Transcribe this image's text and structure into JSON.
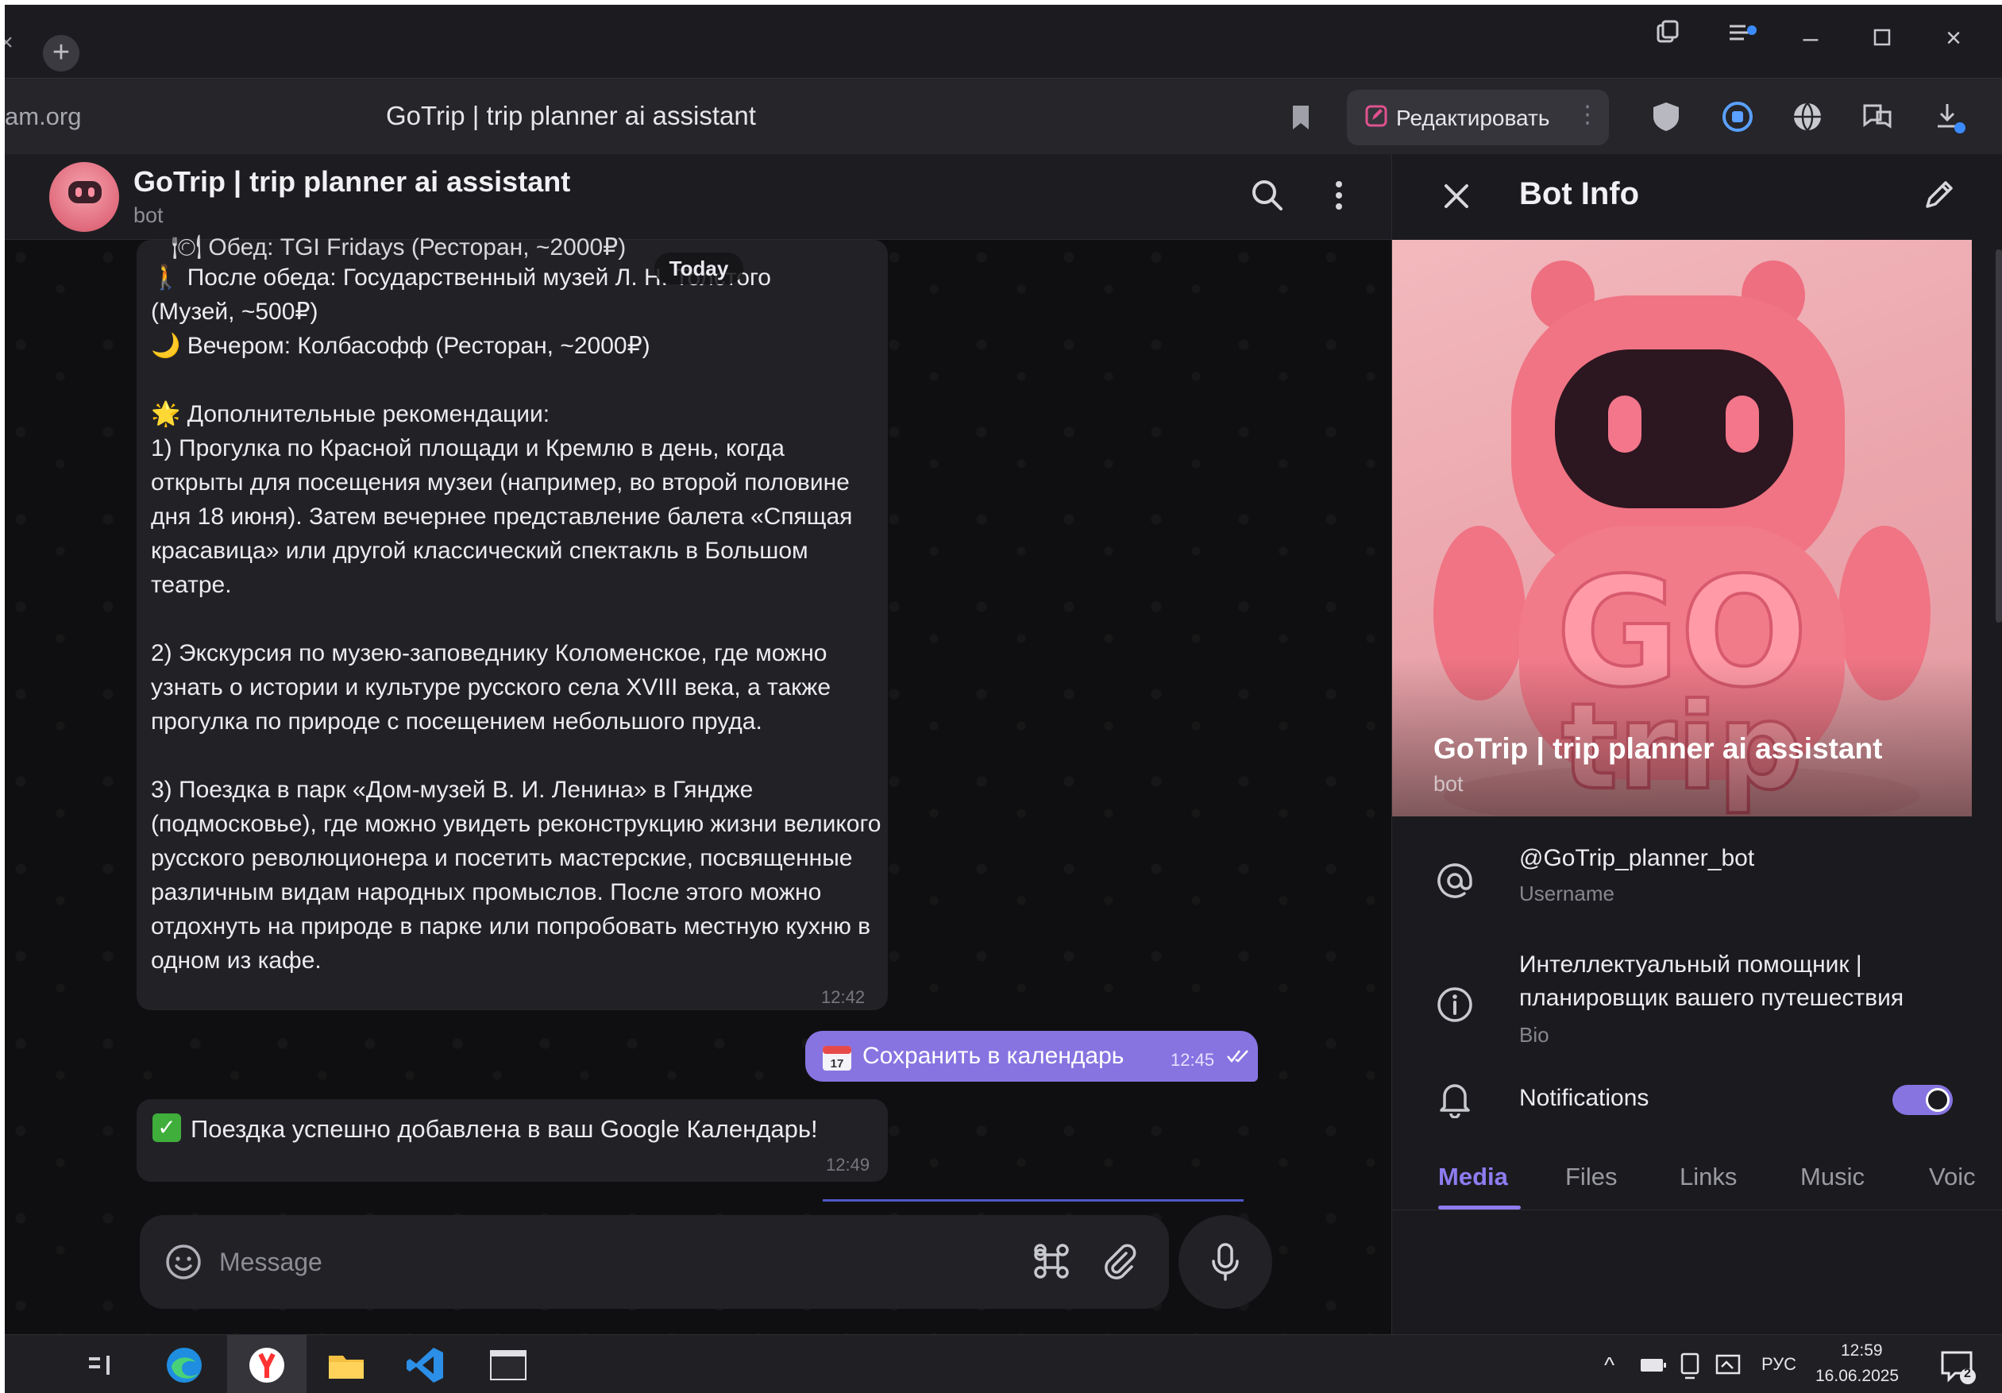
{
  "browser": {
    "url_fragment": "am.org",
    "page_title": "GoTrip | trip planner ai assistant",
    "edit_button_label": "Редактировать"
  },
  "chat": {
    "title": "GoTrip | trip planner ai assistant",
    "subtitle": "bot",
    "today_label": "Today",
    "long_message": {
      "clipped_first_line": "🍽 Обед: TGI Fridays (Ресторан, ~2000₽)",
      "text": "🚶 После обеда: Государственный музей Л. Н. Толстого\n(Музей, ~500₽)\n🌙 Вечером: Колбасофф (Ресторан, ~2000₽)\n\n🌟 Дополнительные рекомендации:\n1) Прогулка по Красной площади и Кремлю в день, когда открыты для посещения музеи (например, во второй половине дня 18 июня). Затем вечернее представление балета «Спящая красавица» или другой классический спектакль в Большом театре.\n\n2) Экскурсия по музею-заповеднику Коломенское, где можно узнать о истории и культуре русского села XVIII века, а также прогулка по природе с посещением небольшого пруда.\n\n3) Поездка в парк «Дом-музей В. И. Ленина» в Гяндже (подмосковье), где можно увидеть реконструкцию жизни великого русского революционера и посетить мастерские, посвященные различным видам народных промыслов. После этого можно отдохнуть на природе в парке или попробовать местную кухню в одном из кафе.",
      "time": "12:42"
    },
    "outgoing": {
      "label": "Сохранить в календарь",
      "time": "12:45"
    },
    "confirmation": {
      "text": "Поездка успешно добавлена в ваш Google Календарь!",
      "time": "12:49"
    },
    "composer": {
      "placeholder": "Message"
    }
  },
  "bot_info": {
    "title": "Bot Info",
    "cover_name": "GoTrip | trip planner ai assistant",
    "cover_sub": "bot",
    "cover_art_text": "GO trip",
    "username": "@GoTrip_planner_bot",
    "username_caption": "Username",
    "bio": "Интеллектуальный помощник | планировщик вашего путешествия",
    "bio_caption": "Bio",
    "notifications_label": "Notifications",
    "notifications_on": true,
    "tabs": [
      "Media",
      "Files",
      "Links",
      "Music",
      "Voic"
    ]
  },
  "taskbar": {
    "lang": "РУС",
    "time": "12:59",
    "date": "16.06.2025",
    "notif_count": "2"
  },
  "colors": {
    "accent": "#8774e1",
    "bubble_in": "#222226",
    "background": "#0f0f11",
    "check_green": "#3fae3b"
  },
  "icons": [
    "search-icon",
    "more-vertical-icon",
    "close-icon",
    "pencil-icon",
    "at-icon",
    "info-icon",
    "bell-icon",
    "emoji-icon",
    "command-icon",
    "paperclip-icon",
    "microphone-icon",
    "calendar-icon",
    "double-check-icon",
    "bookmark-icon"
  ]
}
